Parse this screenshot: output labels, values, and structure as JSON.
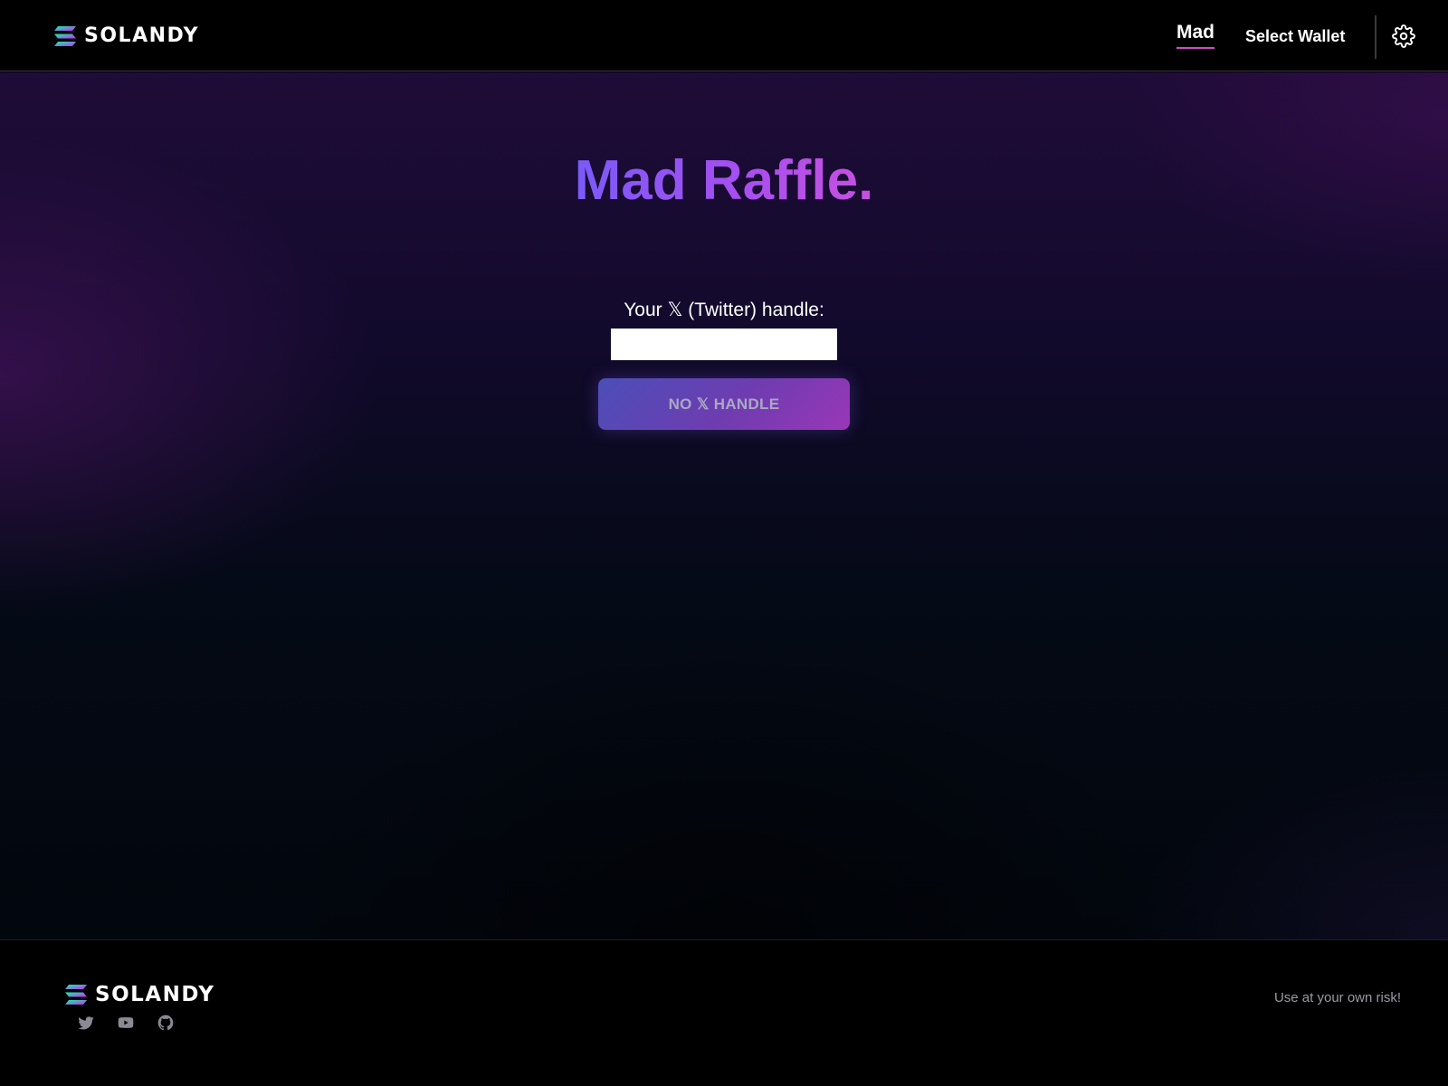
{
  "header": {
    "brand": "SOLANDY",
    "nav_mad": "Mad",
    "select_wallet": "Select Wallet"
  },
  "main": {
    "title": "Mad Raffle.",
    "handle_label": "Your 𝕏 (Twitter) handle:",
    "handle_input_value": "",
    "no_handle_button": "NO 𝕏 HANDLE"
  },
  "footer": {
    "brand": "SOLANDY",
    "disclaimer": "Use at your own risk!",
    "social_icons": [
      "twitter-icon",
      "youtube-icon",
      "github-icon"
    ]
  },
  "colors": {
    "accent_pink": "#c850c0",
    "title_gradient_start": "#7a5af8",
    "title_gradient_end": "#c850e0",
    "button_gradient_start": "#4b4fb8",
    "button_gradient_end": "#9a37b8"
  }
}
